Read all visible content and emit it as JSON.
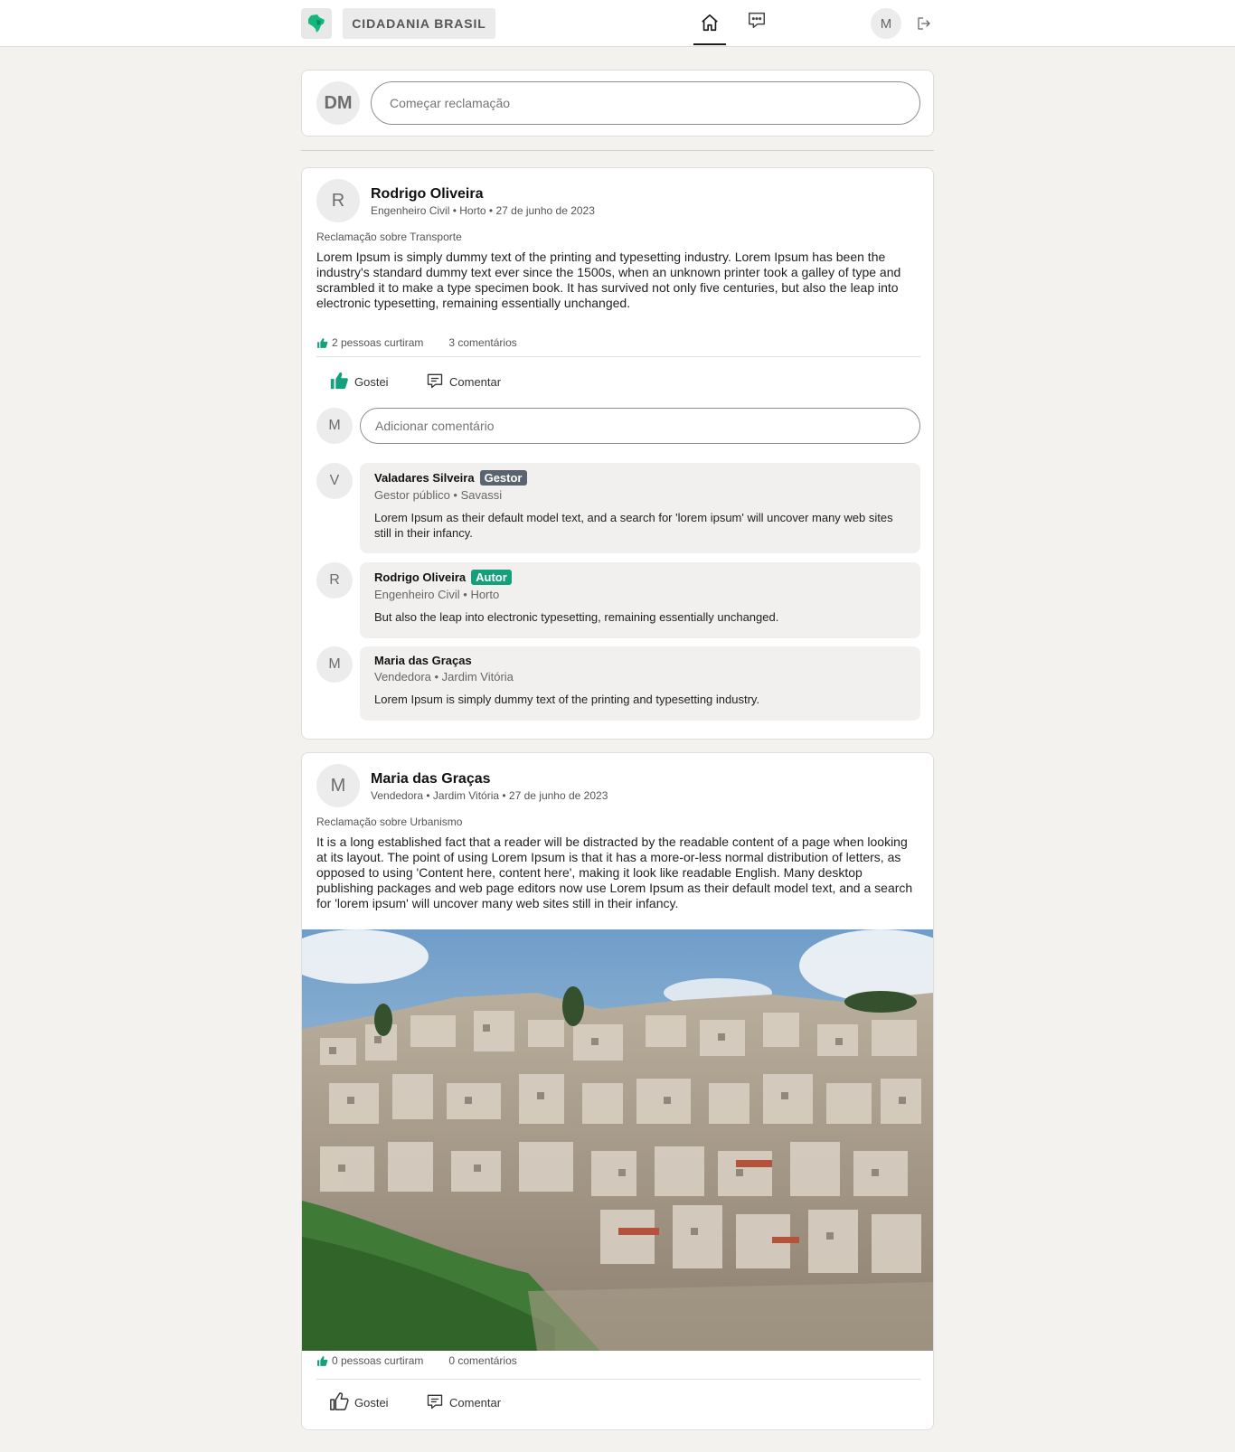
{
  "app": {
    "brand": "CIDADANIA BRASIL",
    "user_initial": "M"
  },
  "composer": {
    "avatar": "DM",
    "placeholder": "Começar reclamação"
  },
  "posts": [
    {
      "avatar": "R",
      "author": "Rodrigo Oliveira",
      "meta": "Engenheiro Civil • Horto • 27 de junho de 2023",
      "subject": "Reclamação sobre Transporte",
      "body": "Lorem Ipsum is simply dummy text of the printing and typesetting industry. Lorem Ipsum has been the industry's standard dummy text ever since the 1500s, when an unknown printer took a galley of type and scrambled it to make a type specimen book. It has survived not only five centuries, but also the leap into electronic typesetting, remaining essentially unchanged.",
      "likes": "2 pessoas curtiram",
      "comments_count": "3 comentários",
      "like_label": "Gostei",
      "comment_label": "Comentar",
      "liked": true,
      "comment_avatar": "M",
      "comment_placeholder": "Adicionar comentário",
      "comments": [
        {
          "avatar": "V",
          "name": "Valadares Silveira",
          "badge": "Gestor",
          "badge_color": "#5a6470",
          "meta": "Gestor público • Savassi",
          "text": "Lorem Ipsum as their default model text, and a search for 'lorem ipsum' will uncover many web sites still in their infancy."
        },
        {
          "avatar": "R",
          "name": "Rodrigo Oliveira",
          "badge": "Autor",
          "badge_color": "#13a07a",
          "meta": "Engenheiro Civil • Horto",
          "text": "But also the leap into electronic typesetting, remaining essentially unchanged."
        },
        {
          "avatar": "M",
          "name": "Maria das Graças",
          "meta": "Vendedora • Jardim Vitória",
          "text": "Lorem Ipsum is simply dummy text of the printing and typesetting industry."
        }
      ]
    },
    {
      "avatar": "M",
      "author": "Maria das Graças",
      "meta": "Vendedora • Jardim Vitória • 27 de junho de 2023",
      "subject": "Reclamação sobre Urbanismo",
      "body": "It is a long established fact that a reader will be distracted by the readable content of a page when looking at its layout. The point of using Lorem Ipsum is that it has a more-or-less normal distribution of letters, as opposed to using 'Content here, content here', making it look like readable English. Many desktop publishing packages and web page editors now use Lorem Ipsum as their default model text, and a search for 'lorem ipsum' will uncover many web sites still in their infancy.",
      "likes": "0 pessoas curtiram",
      "comments_count": "0 comentários",
      "like_label": "Gostei",
      "comment_label": "Comentar",
      "liked": false
    }
  ],
  "colors": {
    "accent": "#13a07a",
    "background": "#f3f2ef"
  },
  "icons": [
    "brazil-map-icon",
    "home-icon",
    "chat-icon",
    "logout-icon",
    "thumbs-up-icon",
    "comment-icon"
  ]
}
